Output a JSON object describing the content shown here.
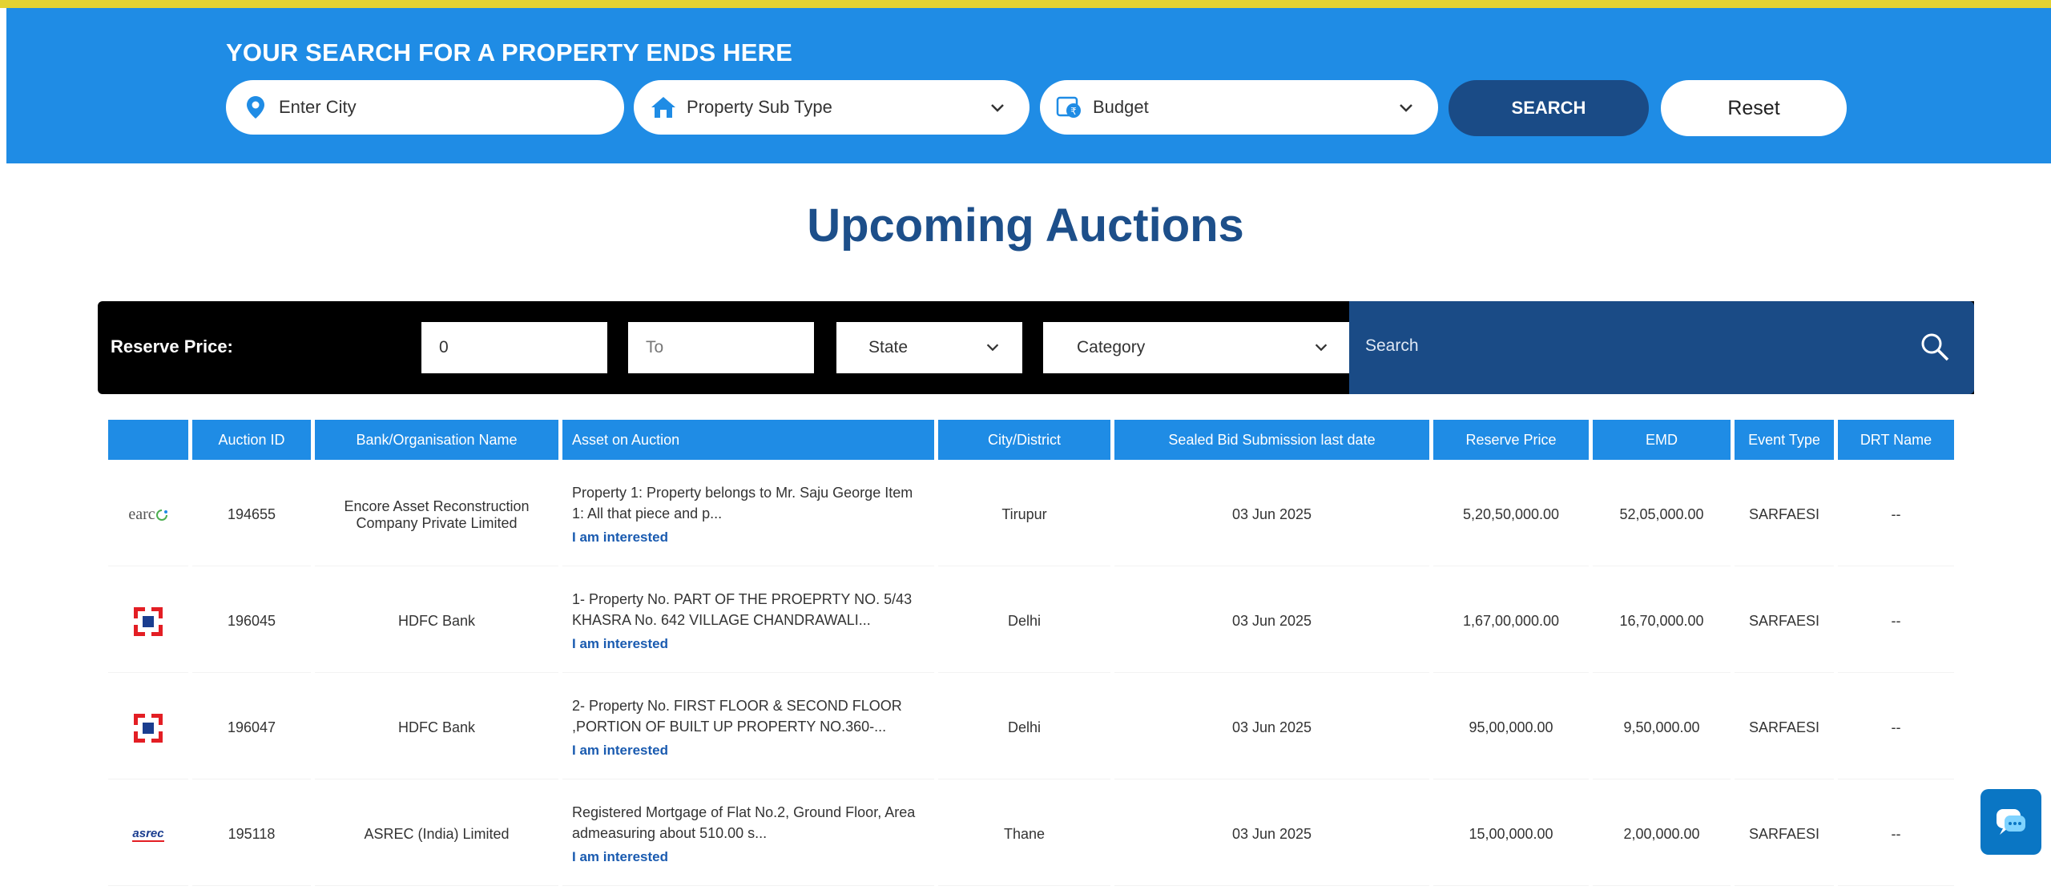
{
  "hero": {
    "title": "YOUR SEARCH FOR A PROPERTY ENDS HERE",
    "city_placeholder": "Enter City",
    "subtype_label": "Property Sub Type",
    "budget_label": "Budget",
    "search_label": "SEARCH",
    "reset_label": "Reset"
  },
  "heading": "Upcoming Auctions",
  "filters": {
    "reserve_label": "Reserve Price:",
    "min_value": "0",
    "max_placeholder": "To",
    "state_label": "State",
    "category_label": "Category",
    "search_placeholder": "Search"
  },
  "table": {
    "headers": [
      "",
      "Auction ID",
      "Bank/Organisation Name",
      "Asset on Auction",
      "City/District",
      "Sealed Bid Submission last date",
      "Reserve Price",
      "EMD",
      "Event Type",
      "DRT Name"
    ],
    "rows": [
      {
        "logo": "earc",
        "id": "194655",
        "bank": "Encore Asset Reconstruction Company Private Limited",
        "asset": "Property 1: Property belongs to Mr. Saju George Item 1: All that piece and p...",
        "link": "I am interested",
        "city": "Tirupur",
        "date": "03 Jun 2025",
        "reserve": "5,20,50,000.00",
        "emd": "52,05,000.00",
        "event": "SARFAESI",
        "drt": "--"
      },
      {
        "logo": "hdfc",
        "id": "196045",
        "bank": "HDFC Bank",
        "asset": "1- Property No. PART OF THE PROEPRTY NO. 5/43 KHASRA No. 642 VILLAGE CHANDRAWALI...",
        "link": "I am interested",
        "city": "Delhi",
        "date": "03 Jun 2025",
        "reserve": "1,67,00,000.00",
        "emd": "16,70,000.00",
        "event": "SARFAESI",
        "drt": "--"
      },
      {
        "logo": "hdfc",
        "id": "196047",
        "bank": "HDFC Bank",
        "asset": "2- Property No. FIRST FLOOR & SECOND FLOOR ,PORTION OF BUILT UP PROPERTY NO.360-...",
        "link": "I am interested",
        "city": "Delhi",
        "date": "03 Jun 2025",
        "reserve": "95,00,000.00",
        "emd": "9,50,000.00",
        "event": "SARFAESI",
        "drt": "--"
      },
      {
        "logo": "asrec",
        "id": "195118",
        "bank": "ASREC (India) Limited",
        "asset": "Registered Mortgage of Flat No.2, Ground Floor, Area admeasuring about 510.00 s...",
        "link": "I am interested",
        "city": "Thane",
        "date": "03 Jun 2025",
        "reserve": "15,00,000.00",
        "emd": "2,00,000.00",
        "event": "SARFAESI",
        "drt": "--"
      }
    ]
  },
  "logos": {
    "earc": "earc",
    "asrec": "asrec"
  },
  "colors": {
    "brand_blue": "#1f8ce5",
    "navy": "#1a4b86",
    "heading": "#1d4f8a",
    "topline": "#e3d233"
  }
}
